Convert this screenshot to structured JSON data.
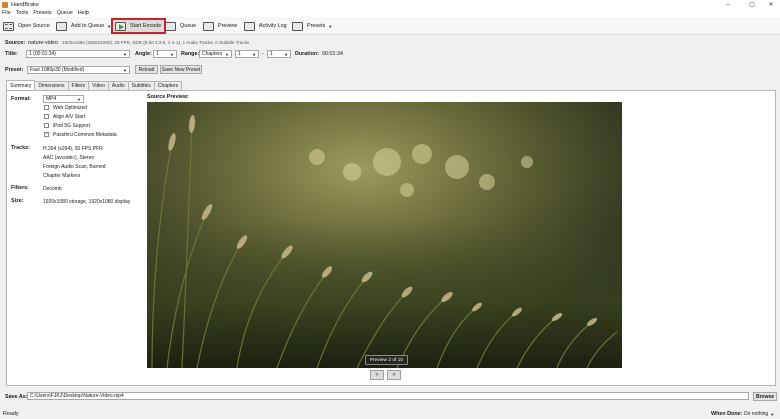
{
  "window": {
    "title": "HandBrake",
    "controls": [
      "–",
      "▢",
      "✕"
    ]
  },
  "menu": [
    "File",
    "Tools",
    "Presets",
    "Queue",
    "Help"
  ],
  "toolbar": {
    "open_source": "Open Source",
    "add_to_queue": "Add to Queue",
    "start_encode": "Start Encode",
    "queue": "Queue",
    "preview": "Preview",
    "activity_log": "Activity Log",
    "presets": "Presets",
    "highlight_color": "#c0262c"
  },
  "source": {
    "label": "Source:",
    "name": "nature-video",
    "info": "1920x1080 (1920x1080), 25 FPS, SDR (8-bit 4:2:0, 1-1-1), 1 Audio Tracks, 0 Subtitle Tracks"
  },
  "title_row": {
    "title_label": "Title:",
    "title_value": "1 (00:01:34)",
    "angle_label": "Angle:",
    "angle_value": "1",
    "range_label": "Range:",
    "range_value": "Chapters",
    "range_start": "1",
    "range_sep": "-",
    "range_end": "1",
    "duration_label": "Duration:",
    "duration_value": "00:01:34"
  },
  "preset_row": {
    "label": "Preset:",
    "value": "Fast 1080p30 (Modified)",
    "reload": "Reload",
    "save_new": "Save New Preset"
  },
  "tabs": [
    "Summary",
    "Dimensions",
    "Filters",
    "Video",
    "Audio",
    "Subtitles",
    "Chapters"
  ],
  "summary": {
    "format_label": "Format:",
    "format_value": "MP4",
    "options": [
      {
        "label": "Web Optimized",
        "checked": false
      },
      {
        "label": "Align A/V Start",
        "checked": false
      },
      {
        "label": "iPod 5G Support",
        "checked": false
      },
      {
        "label": "Passthru Common Metadata",
        "checked": true
      }
    ],
    "tracks_label": "Tracks:",
    "tracks": [
      "H.264 (x264), 30 FPS PFR",
      "AAC (avcodec), Stereo",
      "Foreign Audio Scan, Burned",
      "Chapter Markers"
    ],
    "filters_label": "Filters:",
    "filters_value": "Decomb",
    "size_label": "Size:",
    "size_value": "1920x1080 storage, 1920x1080 display"
  },
  "preview": {
    "label": "Source Preview:",
    "pill": "Preview 2 of 10",
    "prev": "<",
    "next": ">"
  },
  "save": {
    "label": "Save As:",
    "path": "C:\\Users\\FJKJ\\Desktop\\Nature-Video.mp4",
    "browse": "Browse"
  },
  "status": {
    "text": "Ready",
    "when_done_label": "When Done:",
    "when_done_value": "Do nothing"
  }
}
